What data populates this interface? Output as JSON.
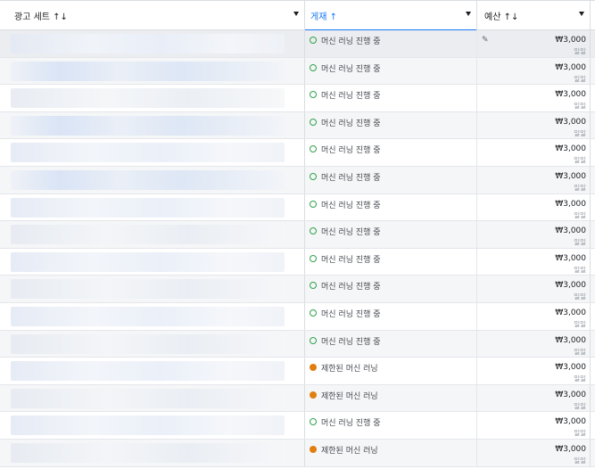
{
  "columns": {
    "name": {
      "label": "광고 세트 ↑↓"
    },
    "status": {
      "label": "게재 ↑"
    },
    "budget": {
      "label": "예산 ↑↓"
    }
  },
  "status_labels": {
    "learning": "머신 러닝 진행 중",
    "limited": "제한된 머신 러닝"
  },
  "colors": {
    "active": "#31a24c",
    "limited": "#e07f10",
    "accent": "#1877f2"
  },
  "rows": [
    {
      "status": "learning",
      "status_text": "머신 러닝 진행 중",
      "amount": "₩3,000",
      "unit": "일일",
      "editable": true
    },
    {
      "status": "learning",
      "status_text": "머신 러닝 진행 중",
      "amount": "₩3,000",
      "unit": "일일"
    },
    {
      "status": "learning",
      "status_text": "머신 러닝 진행 중",
      "amount": "₩3,000",
      "unit": "일일"
    },
    {
      "status": "learning",
      "status_text": "머신 러닝 진행 중",
      "amount": "₩3,000",
      "unit": "일일"
    },
    {
      "status": "learning",
      "status_text": "머신 러닝 진행 중",
      "amount": "₩3,000",
      "unit": "일일"
    },
    {
      "status": "learning",
      "status_text": "머신 러닝 진행 중",
      "amount": "₩3,000",
      "unit": "일일"
    },
    {
      "status": "learning",
      "status_text": "머신 러닝 진행 중",
      "amount": "₩3,000",
      "unit": "일일"
    },
    {
      "status": "learning",
      "status_text": "머신 러닝 진행 중",
      "amount": "₩3,000",
      "unit": "일일"
    },
    {
      "status": "learning",
      "status_text": "머신 러닝 진행 중",
      "amount": "₩3,000",
      "unit": "일일"
    },
    {
      "status": "learning",
      "status_text": "머신 러닝 진행 중",
      "amount": "₩3,000",
      "unit": "일일"
    },
    {
      "status": "learning",
      "status_text": "머신 러닝 진행 중",
      "amount": "₩3,000",
      "unit": "일일"
    },
    {
      "status": "learning",
      "status_text": "머신 러닝 진행 중",
      "amount": "₩3,000",
      "unit": "일일"
    },
    {
      "status": "limited",
      "status_text": "제한된 머신 러닝",
      "amount": "₩3,000",
      "unit": "일일"
    },
    {
      "status": "limited",
      "status_text": "제한된 머신 러닝",
      "amount": "₩3,000",
      "unit": "일일"
    },
    {
      "status": "learning",
      "status_text": "머신 러닝 진행 중",
      "amount": "₩3,000",
      "unit": "일일"
    },
    {
      "status": "limited",
      "status_text": "제한된 머신 러닝",
      "amount": "₩3,000",
      "unit": "일일"
    }
  ]
}
